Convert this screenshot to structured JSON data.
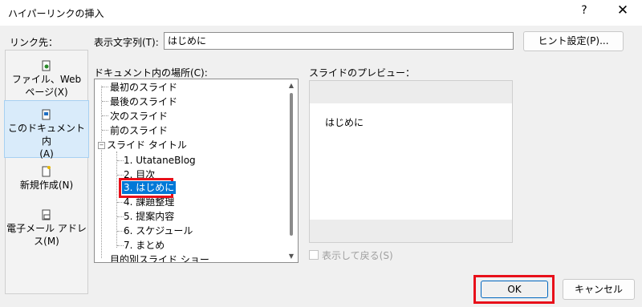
{
  "dialog": {
    "title": "ハイパーリンクの挿入",
    "help": "?",
    "close": "✕"
  },
  "link_to": {
    "label": "リンク先：",
    "items": [
      {
        "line1": "ファイル、Web",
        "line2": "ページ(X)",
        "icon": "file-web-icon"
      },
      {
        "line1": "このドキュメント内",
        "line2": "(A)",
        "icon": "this-document-icon",
        "selected": true
      },
      {
        "line1": "新規作成(N)",
        "line2": "",
        "icon": "new-document-icon"
      },
      {
        "line1": "電子メール アドレ",
        "line2": "ス(M)",
        "icon": "email-icon"
      }
    ]
  },
  "display_text": {
    "label": "表示文字列(T):",
    "value": "はじめに"
  },
  "hint_button": "ヒント設定(P)...",
  "place_label": "ドキュメント内の場所(C):",
  "tree": {
    "items": [
      "最初のスライド",
      "最後のスライド",
      "次のスライド",
      "前のスライド",
      "スライド タイトル",
      "1. UtataneBlog",
      "2. 目次",
      "3. はじめに",
      "4. 課題整理",
      "5. 提案内容",
      "6. スケジュール",
      "7. まとめ",
      "目的別スライド ショー"
    ],
    "selected": "3. はじめに"
  },
  "preview": {
    "label": "スライドのプレビュー：",
    "text": "はじめに"
  },
  "show_return": "表示して戻る(S)",
  "ok": "OK",
  "cancel": "キャンセル",
  "colors": {
    "highlight": "#e8101a",
    "selection": "#0078d7"
  }
}
